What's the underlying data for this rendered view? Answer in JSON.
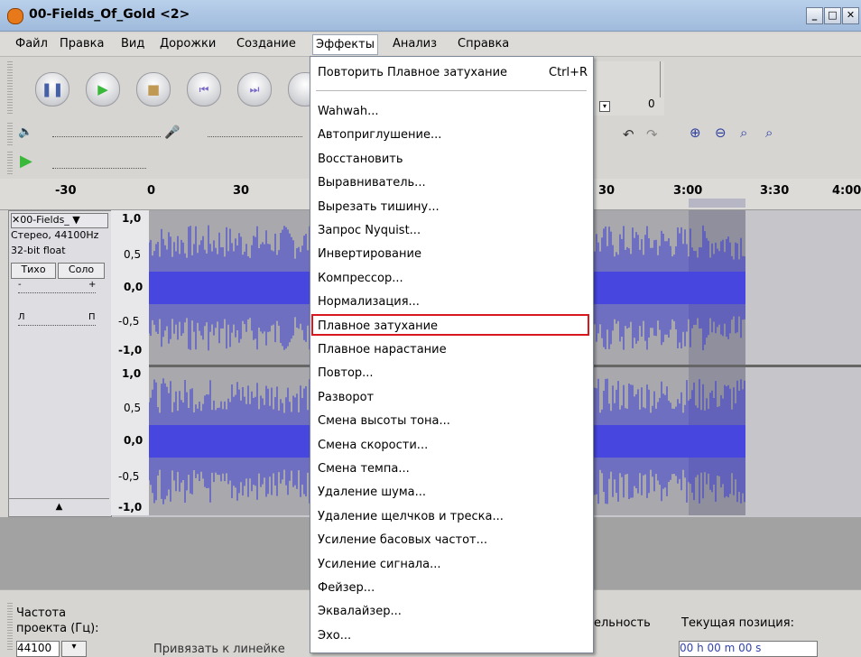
{
  "window": {
    "title": "00-Fields_Of_Gold <2>",
    "buttons": [
      "_",
      "□",
      "✕"
    ]
  },
  "menubar": {
    "items": [
      "Файл",
      "Правка",
      "Вид",
      "Дорожки",
      "Создание",
      "Эффекты",
      "Анализ",
      "Справка"
    ]
  },
  "toolbar": {
    "meter_right_value": "0",
    "icons": [
      "pause-icon",
      "play-icon",
      "stop-icon",
      "skip-start-icon",
      "skip-end-icon"
    ]
  },
  "ruler": {
    "labels": [
      "-30",
      "0",
      "30",
      "30",
      "3:00",
      "3:30",
      "4:00"
    ]
  },
  "track": {
    "name": "00-Fields_",
    "info_line1": "Стерео, 44100Hz",
    "info_line2": "32-bit float",
    "mute": "Тихо",
    "solo": "Соло",
    "gain_minus": "-",
    "gain_plus": "+",
    "pan_left": "Л",
    "pan_right": "П",
    "collapse": "▲",
    "scale": [
      "1,0",
      "0,5",
      "0,0",
      "-0,5",
      "-1,0"
    ]
  },
  "bottom": {
    "rate_label_1": "Частота",
    "rate_label_2": "проекта (Гц):",
    "rate_value": "44100",
    "snap_label": "Привязать к линейке",
    "length_label": "ельность",
    "position_label": "Текущая позиция:",
    "position_value": "00 h 00 m 00 s"
  },
  "effects_menu": {
    "repeat": "Повторить Плавное затухание",
    "repeat_shortcut": "Ctrl+R",
    "items": [
      "Wahwah...",
      "Автоприглушение...",
      "Восстановить",
      "Выравниватель...",
      "Вырезать тишину...",
      "Запрос Nyquist...",
      "Инвертирование",
      "Компрессор...",
      "Нормализация...",
      "Плавное затухание",
      "Плавное нарастание",
      "Повтор...",
      "Разворот",
      "Смена высоты тона...",
      "Смена скорости...",
      "Смена темпа...",
      "Удаление шума...",
      "Удаление щелчков и треска...",
      "Усиление басовых частот...",
      "Усиление сигнала...",
      "Фейзер...",
      "Эквалайзер...",
      "Эхо..."
    ],
    "highlighted_index": 9
  },
  "colors": {
    "waveform": "#3535d6",
    "highlight_border": "#d7191f",
    "titlebar": "#a9c3e3"
  }
}
